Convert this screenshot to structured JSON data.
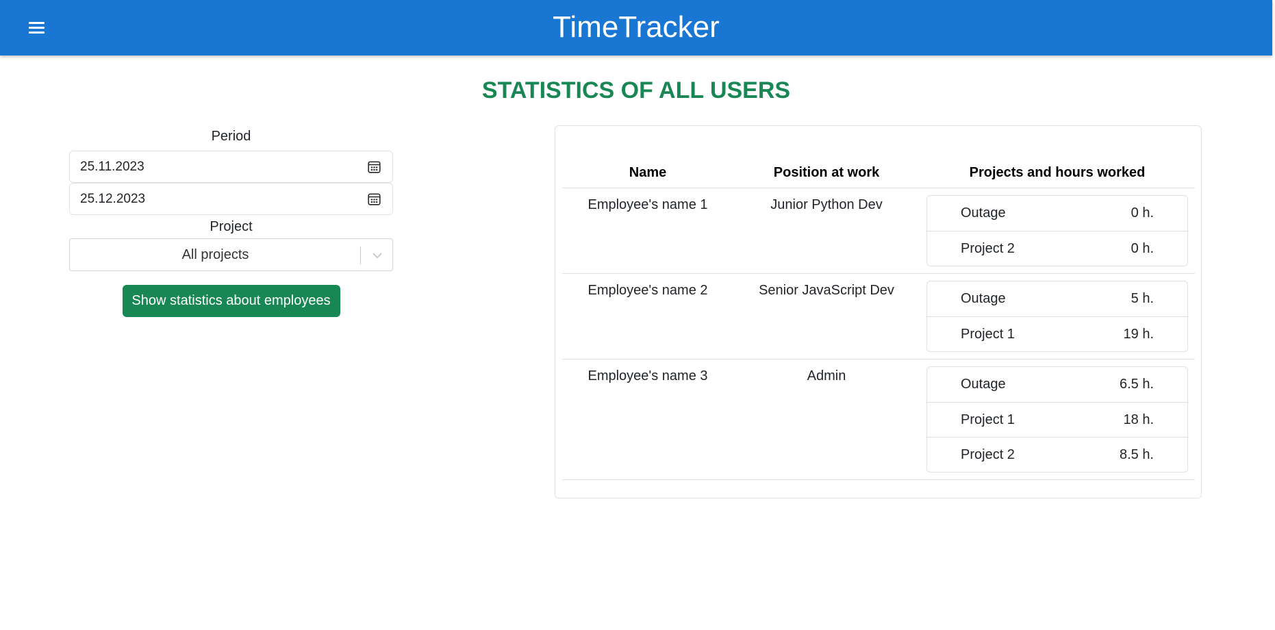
{
  "header": {
    "app_title": "TimeTracker",
    "menu_icon": "menu-icon",
    "background": "#1976d2"
  },
  "page": {
    "title": "STATISTICS OF ALL USERS",
    "title_color": "#198754"
  },
  "filters": {
    "period_label": "Period",
    "date_from": "25.11.2023",
    "date_to": "25.12.2023",
    "project_label": "Project",
    "project_selected": "All projects",
    "submit_label": "Show statistics about employees"
  },
  "table": {
    "columns": [
      "Name",
      "Position at work",
      "Projects and hours worked"
    ],
    "rows": [
      {
        "name": "Employee's name 1",
        "position": "Junior Python Dev",
        "projects": [
          {
            "project": "Outage",
            "hours": "0 h."
          },
          {
            "project": "Project 2",
            "hours": "0 h."
          }
        ]
      },
      {
        "name": "Employee's name 2",
        "position": "Senior JavaScript Dev",
        "projects": [
          {
            "project": "Outage",
            "hours": "5 h."
          },
          {
            "project": "Project 1",
            "hours": "19 h."
          }
        ]
      },
      {
        "name": "Employee's name 3",
        "position": "Admin",
        "projects": [
          {
            "project": "Outage",
            "hours": "6.5 h."
          },
          {
            "project": "Project 1",
            "hours": "18 h."
          },
          {
            "project": "Project 2",
            "hours": "8.5 h."
          }
        ]
      }
    ]
  }
}
